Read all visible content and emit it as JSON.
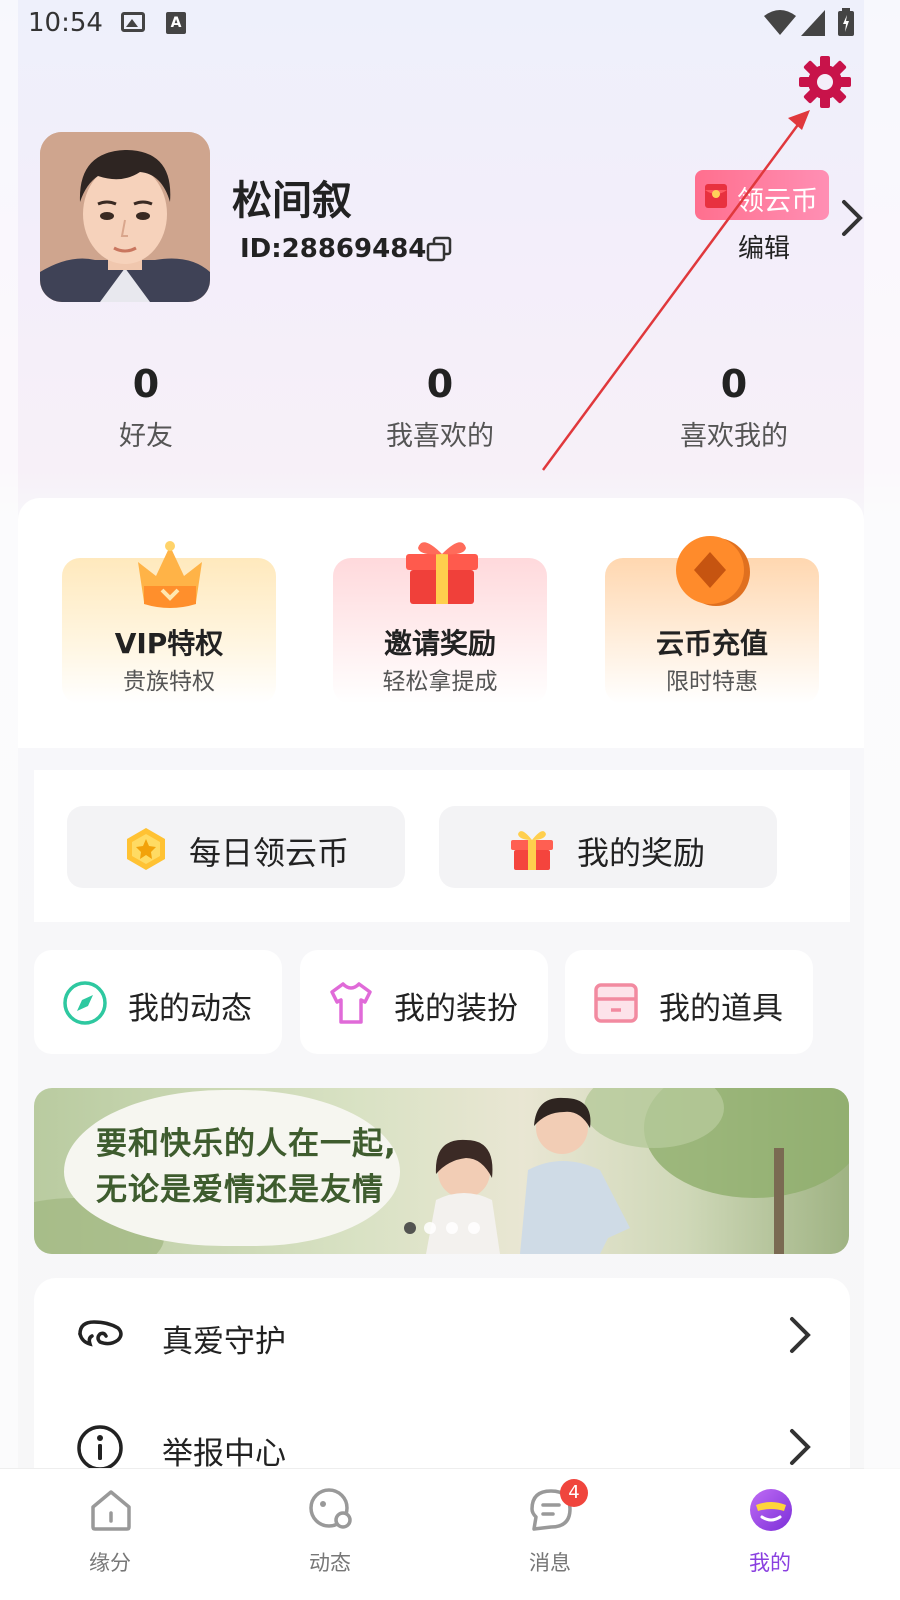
{
  "status_bar": {
    "time": "10:54",
    "icons": [
      "image-icon",
      "text-a-icon",
      "wifi-icon",
      "signal-icon",
      "battery-icon"
    ]
  },
  "header": {
    "settings_icon": "gear-icon",
    "settings_color": "#c8134a"
  },
  "profile": {
    "name": "松间叙",
    "id_label": "ID:28869484",
    "coin_badge_label": "领云币",
    "edit_label": "编辑"
  },
  "stats": [
    {
      "value": "0",
      "label": "好友"
    },
    {
      "value": "0",
      "label": "我喜欢的"
    },
    {
      "value": "0",
      "label": "喜欢我的"
    }
  ],
  "feature_cards": [
    {
      "title": "VIP特权",
      "subtitle": "贵族特权",
      "icon": "crown-icon"
    },
    {
      "title": "邀请奖励",
      "subtitle": "轻松拿提成",
      "icon": "gift-box-icon"
    },
    {
      "title": "云币充值",
      "subtitle": "限时特惠",
      "icon": "coin-icon"
    }
  ],
  "quick_actions": [
    {
      "label": "每日领云币",
      "icon": "coin-badge-icon"
    },
    {
      "label": "我的奖励",
      "icon": "gift-icon"
    }
  ],
  "my_items": [
    {
      "label": "我的动态",
      "icon": "compass-icon"
    },
    {
      "label": "我的装扮",
      "icon": "shirt-icon"
    },
    {
      "label": "我的道具",
      "icon": "box-icon"
    }
  ],
  "banner": {
    "line1": "要和快乐的人在一起,",
    "line2": "无论是爱情还是友情",
    "page_count": 4,
    "active_page": 1
  },
  "list": [
    {
      "label": "真爱守护",
      "icon": "cloud-wing-icon"
    },
    {
      "label": "举报中心",
      "icon": "info-icon"
    }
  ],
  "bottom_nav": [
    {
      "label": "缘分",
      "icon": "home-icon",
      "active": false
    },
    {
      "label": "动态",
      "icon": "planet-icon",
      "active": false
    },
    {
      "label": "消息",
      "icon": "message-icon",
      "active": false,
      "badge": "4"
    },
    {
      "label": "我的",
      "icon": "me-icon",
      "active": true
    }
  ],
  "colors": {
    "accent_purple": "#8a3fe0",
    "badge_red": "#f0453d",
    "coin_pink": "#ff6f8e",
    "annotation_red": "#e0383c"
  }
}
